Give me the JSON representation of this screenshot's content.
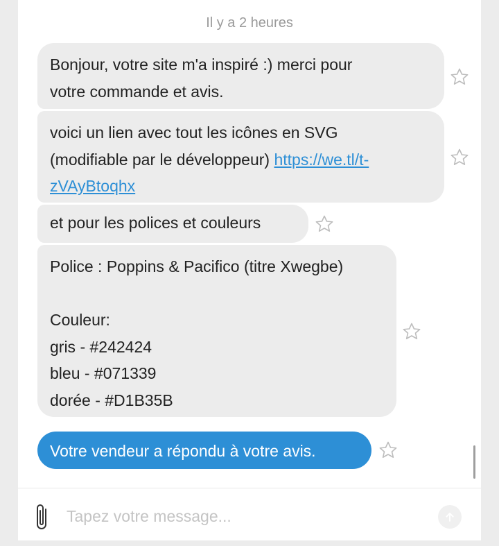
{
  "conversation": {
    "timestamp": "Il y a 2 heures",
    "messages": [
      {
        "line1": "Bonjour, votre site m'a inspiré :) merci pour",
        "line2": "votre commande et avis."
      },
      {
        "line1": "voici un lien avec tout les icônes en SVG",
        "line2_prefix": "(modifiable par le développeur) ",
        "link_part1": "https://we.tl/t-",
        "link_part2": "zVAyBtoqhx"
      },
      {
        "line1": "et pour les polices et couleurs"
      },
      {
        "line1": "Police : Poppins & Pacifico (titre Xwegbe)",
        "line2": "Couleur:",
        "line3": "gris - #242424",
        "line4": "bleu - #071339",
        "line5": "dorée - #D1B35B"
      },
      {
        "line1": "Votre vendeur a répondu à votre avis."
      }
    ]
  },
  "composer": {
    "placeholder": "Tapez votre message..."
  },
  "colors": {
    "bubble_gray": "#ececec",
    "bubble_blue": "#2d8fd6",
    "link": "#2d8fd6"
  },
  "icons": {
    "star": "star-outline-icon",
    "attach": "paperclip-icon",
    "send": "arrow-up-icon"
  }
}
